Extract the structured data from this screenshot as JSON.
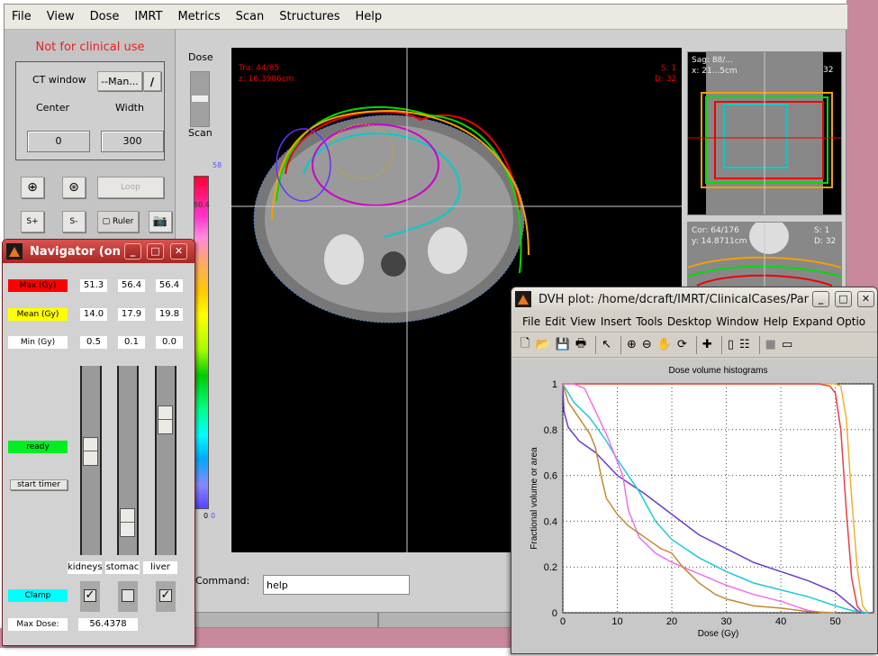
{
  "main_window": {
    "menu": [
      "File",
      "View",
      "Dose",
      "IMRT",
      "Metrics",
      "Scan",
      "Structures",
      "Help"
    ],
    "warning": "Not for clinical use",
    "ct_window": {
      "label": "CT window",
      "preset": "--Man...",
      "center_label": "Center",
      "width_label": "Width",
      "center_value": "0",
      "width_value": "300"
    },
    "buttons": {
      "loop": "Loop",
      "s_plus": "S+",
      "s_minus": "S-",
      "ruler": "Ruler"
    },
    "dose_label": "Dose",
    "scan_label": "Scan",
    "colorbar": {
      "max_label": "58",
      "marker_label": "50.4",
      "min_label_left": "0",
      "min_label_right": "0"
    },
    "transverse": {
      "slice": "Tra: 44/85",
      "z": "z: 16.3986cm",
      "s": "S: 1",
      "d": "D: 32"
    },
    "sagittal": {
      "slice": "Sag: 88/...",
      "x": "x: 21...5cm",
      "d": "32"
    },
    "coronal": {
      "slice": "Cor: 64/176",
      "y": "y: 14.8711cm",
      "s": "S: 1",
      "d": "D: 32"
    },
    "command_label": "Command:",
    "command_value": "help"
  },
  "navigator": {
    "title": "Navigator (on si",
    "rows": [
      {
        "label": "Max (Gy)",
        "color": "#ff0000",
        "values": [
          "51.3",
          "56.4",
          "56.4"
        ]
      },
      {
        "label": "Mean (Gy)",
        "color": "#ffff00",
        "values": [
          "14.0",
          "17.9",
          "19.8"
        ]
      },
      {
        "label": "Min (Gy)",
        "color": "#ffffff",
        "values": [
          "0.5",
          "0.1",
          "0.0"
        ]
      }
    ],
    "status": "ready",
    "start_timer": "start timer",
    "structures": [
      {
        "name": "kidneys",
        "slider_position": 0.55,
        "clamp": true
      },
      {
        "name": "stomac",
        "slider_position": 0.1,
        "clamp": false
      },
      {
        "name": "liver",
        "slider_position": 0.75,
        "clamp": true
      }
    ],
    "clamp_label": "Clamp",
    "max_dose_label": "Max Dose:",
    "max_dose_value": "56.4378"
  },
  "dvh_window": {
    "title": "DVH plot: /home/dcraft/IMRT/ClinicalCases/Panc",
    "menu": [
      "File",
      "Edit",
      "View",
      "Insert",
      "Tools",
      "Desktop",
      "Window",
      "Help",
      "Expand Optio"
    ]
  },
  "chart_data": {
    "type": "line",
    "title": "Dose volume histograms",
    "xlabel": "Dose (Gy)",
    "ylabel": "Fractional volume or area",
    "xlim": [
      0,
      57
    ],
    "ylim": [
      0,
      1
    ],
    "xticks": [
      0,
      10,
      20,
      30,
      40,
      50
    ],
    "yticks": [
      0,
      0.2,
      0.4,
      0.6,
      0.8,
      1
    ],
    "grid": true,
    "series": [
      {
        "name": "orange",
        "color": "#f0b030",
        "x": [
          0,
          50,
          51,
          52,
          53,
          54,
          55,
          56
        ],
        "y": [
          1,
          1,
          0.99,
          0.85,
          0.5,
          0.2,
          0.03,
          0
        ]
      },
      {
        "name": "red",
        "color": "#e84040",
        "x": [
          0,
          47,
          49,
          50,
          51,
          52,
          53,
          54,
          55
        ],
        "y": [
          1,
          1,
          0.99,
          0.96,
          0.8,
          0.45,
          0.15,
          0.03,
          0
        ]
      },
      {
        "name": "purple",
        "color": "#6a3cd0",
        "x": [
          0,
          0.2,
          1,
          3,
          6,
          10,
          15,
          20,
          25,
          30,
          35,
          40,
          45,
          50,
          52,
          54,
          55
        ],
        "y": [
          1,
          0.88,
          0.81,
          0.75,
          0.7,
          0.6,
          0.52,
          0.43,
          0.34,
          0.28,
          0.22,
          0.18,
          0.14,
          0.09,
          0.05,
          0.01,
          0
        ]
      },
      {
        "name": "cyan",
        "color": "#20c8d8",
        "x": [
          0,
          2,
          5,
          8,
          10,
          12,
          14,
          17,
          20,
          25,
          30,
          35,
          40,
          45,
          50,
          53,
          56
        ],
        "y": [
          1,
          0.92,
          0.85,
          0.75,
          0.67,
          0.6,
          0.53,
          0.4,
          0.32,
          0.24,
          0.18,
          0.13,
          0.1,
          0.07,
          0.03,
          0.01,
          0
        ]
      },
      {
        "name": "magenta",
        "color": "#f070e8",
        "x": [
          0,
          2,
          4,
          6,
          8,
          10,
          11,
          12,
          14,
          17,
          20,
          25,
          30,
          35,
          40,
          45,
          48
        ],
        "y": [
          1,
          1,
          0.98,
          0.88,
          0.78,
          0.66,
          0.6,
          0.45,
          0.33,
          0.26,
          0.22,
          0.17,
          0.12,
          0.08,
          0.05,
          0.01,
          0
        ]
      },
      {
        "name": "brown",
        "color": "#c08a30",
        "x": [
          0,
          1,
          3,
          5,
          6,
          7,
          8,
          10,
          12,
          15,
          18,
          20,
          22,
          25,
          28,
          30,
          35,
          40,
          45,
          50
        ],
        "y": [
          1,
          0.92,
          0.85,
          0.78,
          0.72,
          0.6,
          0.5,
          0.43,
          0.38,
          0.33,
          0.28,
          0.26,
          0.2,
          0.13,
          0.08,
          0.06,
          0.03,
          0.02,
          0.005,
          0
        ]
      }
    ]
  }
}
